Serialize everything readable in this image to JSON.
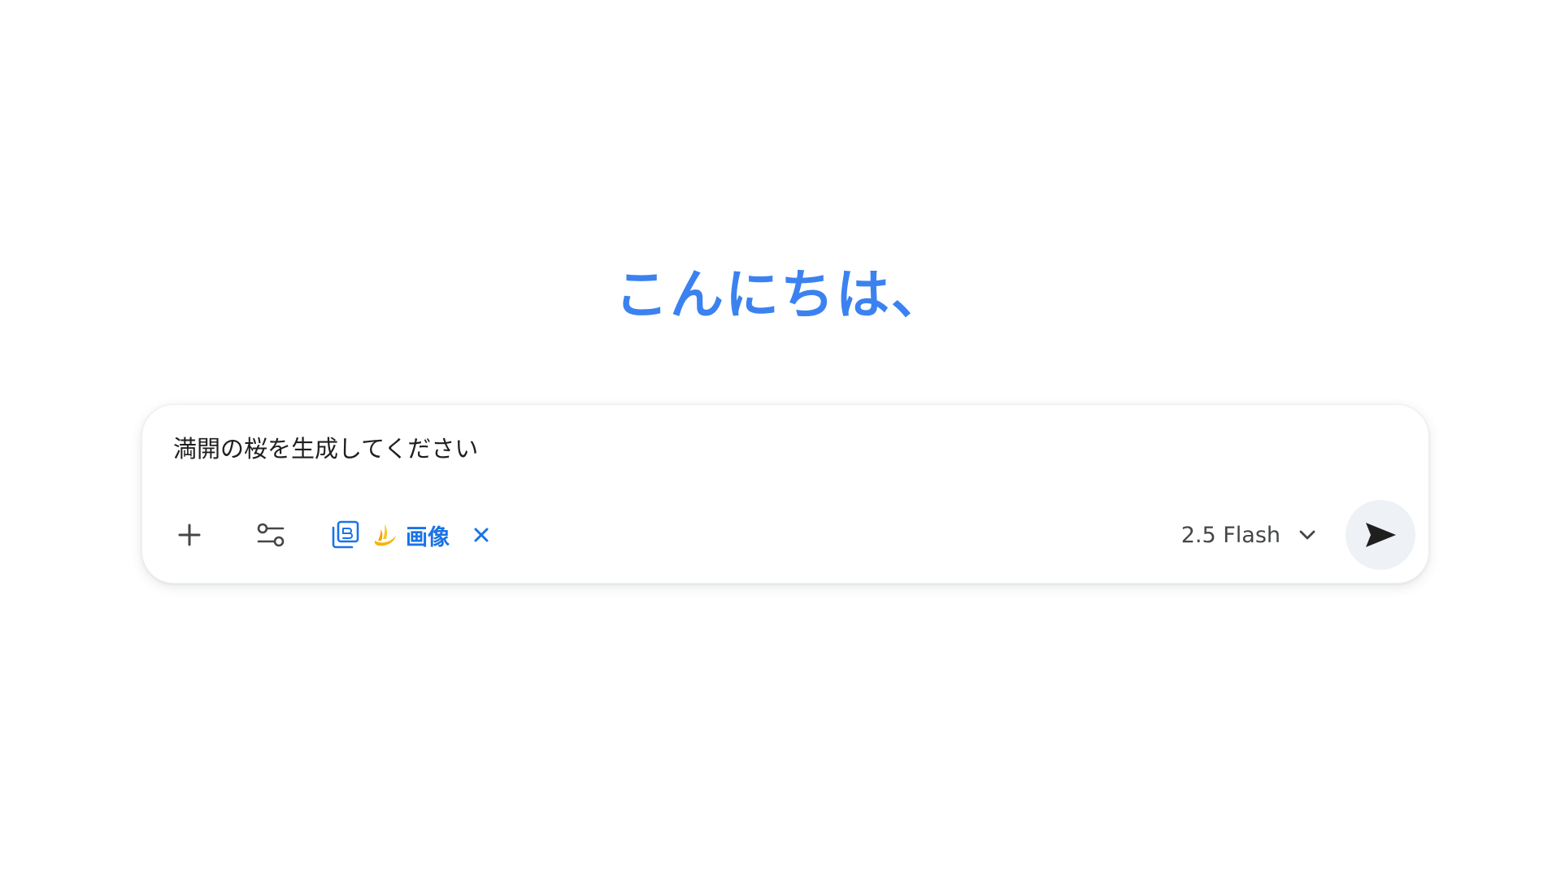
{
  "greeting": "こんにちは、",
  "composer": {
    "prompt_value": "満開の桜を生成してください",
    "add_icon": "plus-icon",
    "tools_icon": "tune-icon",
    "active_tool": {
      "icon": "image-gallery-icon",
      "emoji_icon": "banana-icon",
      "label": "画像",
      "close_icon": "close-icon"
    },
    "model": {
      "label": "2.5 Flash",
      "chevron_icon": "chevron-down-icon"
    },
    "send_icon": "send-icon"
  },
  "colors": {
    "accent": "#1a73e8",
    "greeting": "#3b82f0",
    "icon": "#444746",
    "send_bg": "#eef1f6"
  }
}
